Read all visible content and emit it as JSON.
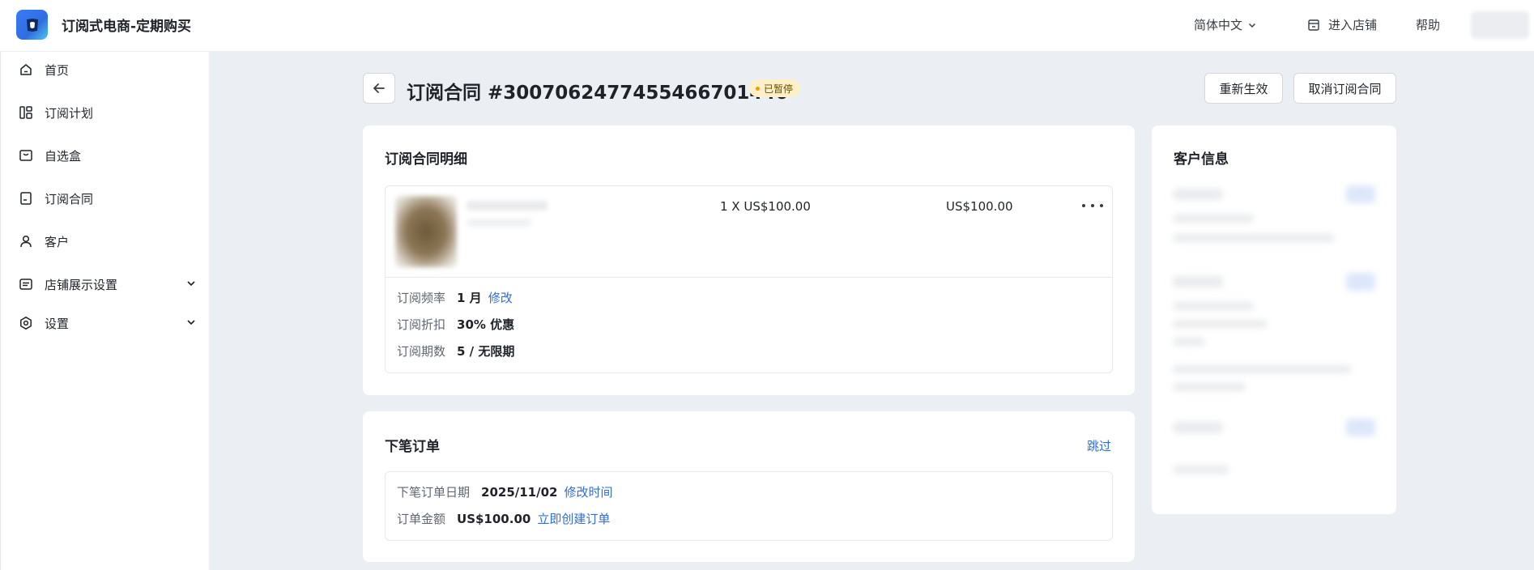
{
  "header": {
    "app_title": "订阅式电商-定期购买",
    "language": "简体中文",
    "enter_shop": "进入店铺",
    "help": "帮助"
  },
  "sidebar": {
    "items": [
      {
        "label": "首页",
        "icon": "home-icon"
      },
      {
        "label": "订阅计划",
        "icon": "plan-icon"
      },
      {
        "label": "自选盒",
        "icon": "box-icon"
      },
      {
        "label": "订阅合同",
        "icon": "contract-icon"
      },
      {
        "label": "客户",
        "icon": "user-icon"
      },
      {
        "label": "店铺展示设置",
        "icon": "display-icon",
        "expandable": true
      },
      {
        "label": "设置",
        "icon": "settings-icon",
        "expandable": true
      }
    ]
  },
  "page": {
    "title": "订阅合同 #30070624774554667014​40",
    "status": "已暂停",
    "actions": {
      "reactivate": "重新生效",
      "cancel": "取消订阅合同"
    }
  },
  "contract_detail": {
    "title": "订阅合同明细",
    "line_item": {
      "qty_price": "1 X US$100.00",
      "total": "US$100.00"
    },
    "fields": [
      {
        "label": "订阅频率",
        "value": "1 月",
        "link": "修改"
      },
      {
        "label": "订阅折扣",
        "value": "30% 优惠"
      },
      {
        "label": "订阅期数",
        "value": "5 / 无限期"
      }
    ]
  },
  "next_order": {
    "title": "下笔订单",
    "skip": "跳过",
    "fields": [
      {
        "label": "下笔订单日期",
        "value": "2025/11/02",
        "link": "修改时间"
      },
      {
        "label": "订单金额",
        "value": "US$100.00",
        "link": "立即创建订单"
      }
    ]
  },
  "customer": {
    "title": "客户信息"
  },
  "colors": {
    "accent": "#2f6de0",
    "page_bg": "#ebeef2",
    "badge_bg": "#fdf0c8",
    "badge_dot": "#e5a100"
  }
}
